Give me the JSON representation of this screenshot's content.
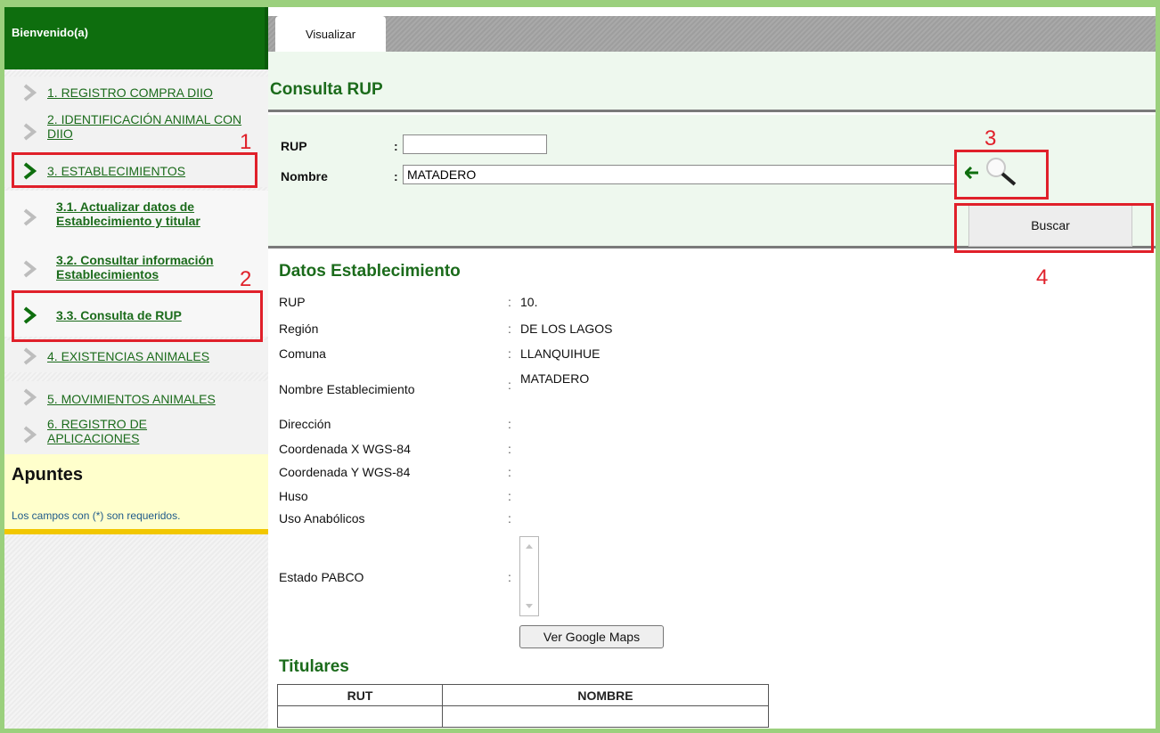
{
  "sidebar": {
    "header": "Bienvenido(a)",
    "items": [
      {
        "label": "1. REGISTRO COMPRA DIIO"
      },
      {
        "label": "2. IDENTIFICACIÓN ANIMAL CON DIIO"
      },
      {
        "label": "3. ESTABLECIMIENTOS"
      },
      {
        "label": "3.1. Actualizar datos de Establecimiento y titular"
      },
      {
        "label": "3.2. Consultar información Establecimientos"
      },
      {
        "label": "3.3. Consulta de RUP"
      },
      {
        "label": "4. EXISTENCIAS ANIMALES"
      },
      {
        "label": "5. MOVIMIENTOS ANIMALES"
      },
      {
        "label": "6. REGISTRO DE APLICACIONES"
      }
    ],
    "notes_title": "Apuntes",
    "notes_text": "Los campos con (*) son requeridos."
  },
  "tabs": [
    {
      "label": "Visualizar"
    }
  ],
  "page_title": "Consulta RUP",
  "form": {
    "rup_label": "RUP",
    "rup_value": "",
    "nombre_label": "Nombre",
    "nombre_value": "MATADERO",
    "colon": ":",
    "search_button": "Buscar"
  },
  "annotations": [
    "1",
    "2",
    "3",
    "4"
  ],
  "datos": {
    "title": "Datos Establecimiento",
    "rows": [
      {
        "label": "RUP",
        "value": "10."
      },
      {
        "label": "Región",
        "value": "DE LOS LAGOS"
      },
      {
        "label": "Comuna",
        "value": "LLANQUIHUE"
      },
      {
        "label": "Nombre Establecimiento",
        "value": "MATADERO"
      },
      {
        "label": "Dirección",
        "value": ""
      },
      {
        "label": "Coordenada X WGS-84",
        "value": ""
      },
      {
        "label": "Coordenada Y WGS-84",
        "value": ""
      },
      {
        "label": "Huso",
        "value": ""
      },
      {
        "label": "Uso Anabólicos",
        "value": ""
      },
      {
        "label": "Estado PABCO",
        "value": ""
      }
    ],
    "colon": ":",
    "maps_button": "Ver Google Maps"
  },
  "titulares": {
    "title": "Titulares",
    "columns": [
      "RUT",
      "NOMBRE"
    ]
  },
  "colors": {
    "brand_green": "#0e6e0e",
    "link_green": "#1b6b1b",
    "annotation_red": "#e0202a",
    "frame_green": "#9bd07d"
  }
}
